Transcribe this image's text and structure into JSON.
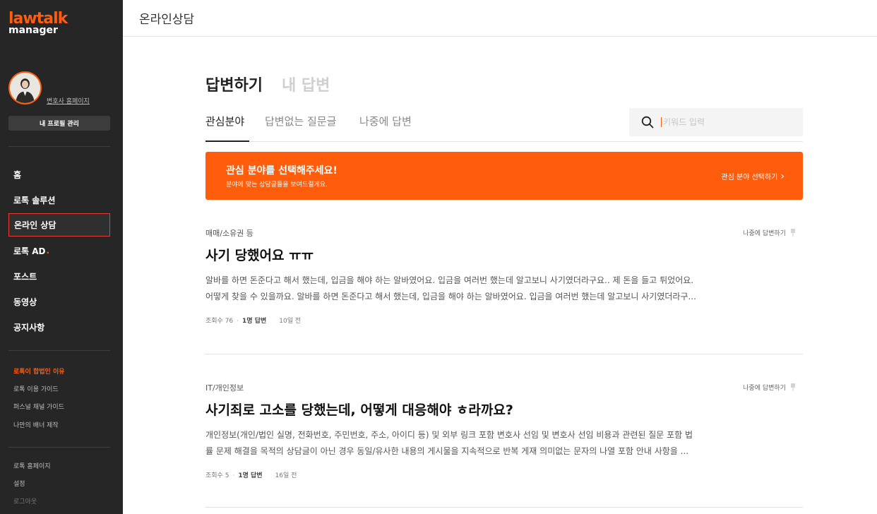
{
  "sidebar": {
    "logo_top": "lawtalk",
    "logo_bottom": "manager",
    "homepage_link": "변호사 홈페이지",
    "profile_button": "내 프로필 관리",
    "nav": {
      "home": "홈",
      "solution": "로톡 솔루션",
      "consult": "온라인 상담",
      "ad": "로톡 AD",
      "ad_dot": ".",
      "post": "포스트",
      "video": "동영상",
      "notice": "공지사항"
    },
    "links": {
      "why_legal": "로톡이 합법인 이유",
      "guide": "로톡 이용 가이드",
      "personal_channel": "퍼스널 채널 가이드",
      "banner": "나만의 배너 제작",
      "homepage": "로톡 홈페이지",
      "settings": "설정",
      "logout": "로그아웃"
    }
  },
  "topbar": {
    "title": "온라인상담"
  },
  "main": {
    "tabs": {
      "answer": "답변하기",
      "my_answers": "내 답변"
    },
    "subtabs": {
      "interest": "관심분야",
      "unanswered": "답변없는 질문글",
      "later": "나중에 답변"
    },
    "search": {
      "placeholder": "키워드 입력"
    },
    "banner": {
      "title": "관심 분야를 선택해주세요!",
      "subtitle": "분야에 맞는 상담글들을 보여드릴게요.",
      "link": "관심 분야 선택하기",
      "link_arrow": "›"
    },
    "posts": [
      {
        "category": "매매/소유권 등",
        "later": "나중에 답변하기",
        "title": "사기 당했어요 ㅠㅠ",
        "body_line1": "알바를 하면 돈준다고 해서 했는데, 입금을 해야 하는 알바였어요. 입금을 여러번 했는데 알고보니 사기였더라구요.. 제 돈을 들고 튀었어요.",
        "body_line2": "어떻게 찾을 수 있을까요. 알바를 하면 돈준다고 해서 했는데, 입금을 해야 하는 알바였어요. 입금을 여러번 했는데 알고보니 사기였더라구...",
        "views": "조회수 76",
        "answers": "1명 답변",
        "date": "10일 전"
      },
      {
        "category": "IT/개인정보",
        "later": "나중에 답변하기",
        "title": "사기죄로 고소를 당했는데, 어떻게 대응해야 ㅎ라까요?",
        "body_line1": "개인정보(개인/법인 실명, 전화번호, 주민번호, 주소, 아이디 등) 및 외부 링크 포함 변호사 선임 및 변호사 선임 비용과 관련된 질문 포함 법",
        "body_line2": "률 문제 해결을 목적의 상담글이 아닌 경우 동일/유사한 내용의 게시물을 지속적으로 반복 게재 의미없는 문자의 나열 포함 안내 사항을 ...",
        "views": "조회수 5",
        "answers": "1명 답변",
        "date": "16일 전"
      }
    ],
    "meta_separator": "·"
  },
  "colors": {
    "accent": "#ff5c0b",
    "sidebar_bg": "#262626",
    "active_border": "#e83b2f"
  }
}
